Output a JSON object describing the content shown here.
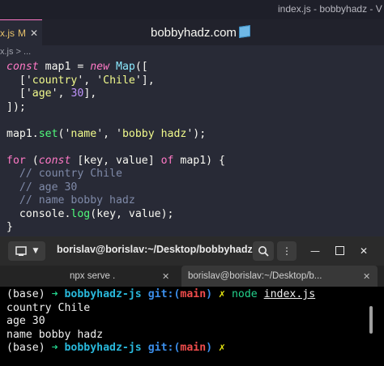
{
  "window": {
    "title": "index.js - bobbyhadz - V"
  },
  "editor_tab": {
    "filename": "x.js",
    "modified_marker": "M",
    "close_glyph": "✕"
  },
  "brand": {
    "text": "bobbyhadz.com",
    "icon": "cube-icon"
  },
  "breadcrumb": "x.js > ...",
  "code": [
    [
      [
        "kw",
        "const"
      ],
      [
        "p",
        " map1 = "
      ],
      [
        "kw",
        "new"
      ],
      [
        "p",
        " "
      ],
      [
        "cls",
        "Map"
      ],
      [
        "p",
        "(["
      ]
    ],
    [
      [
        "ig",
        "  "
      ],
      [
        "p",
        "['"
      ],
      [
        "str",
        "country"
      ],
      [
        "p",
        "', '"
      ],
      [
        "str",
        "Chile"
      ],
      [
        "p",
        "'],"
      ]
    ],
    [
      [
        "ig",
        "  "
      ],
      [
        "p",
        "['"
      ],
      [
        "str",
        "age"
      ],
      [
        "p",
        "', "
      ],
      [
        "num",
        "30"
      ],
      [
        "p",
        "],"
      ]
    ],
    [
      [
        "p",
        "]);"
      ]
    ],
    [
      [
        "p",
        ""
      ]
    ],
    [
      [
        "p",
        "map1."
      ],
      [
        "fn",
        "set"
      ],
      [
        "p",
        "('"
      ],
      [
        "str",
        "name"
      ],
      [
        "p",
        "', '"
      ],
      [
        "str",
        "bobby hadz"
      ],
      [
        "p",
        "');"
      ]
    ],
    [
      [
        "p",
        ""
      ]
    ],
    [
      [
        "pr",
        "for"
      ],
      [
        "p",
        " ("
      ],
      [
        "kw",
        "const"
      ],
      [
        "p",
        " [key, value] "
      ],
      [
        "pr",
        "of"
      ],
      [
        "p",
        " map1) {"
      ]
    ],
    [
      [
        "ig",
        "  "
      ],
      [
        "cm",
        "// country Chile"
      ]
    ],
    [
      [
        "ig",
        "  "
      ],
      [
        "cm",
        "// age 30"
      ]
    ],
    [
      [
        "ig",
        "  "
      ],
      [
        "cm",
        "// name bobby hadz"
      ]
    ],
    [
      [
        "ig",
        "  "
      ],
      [
        "p",
        "console."
      ],
      [
        "fn",
        "log"
      ],
      [
        "p",
        "(key, value);"
      ]
    ],
    [
      [
        "p",
        "}"
      ]
    ]
  ],
  "terminal": {
    "title": "borislav@borislav:~/Desktop/bobbyhadz-r...",
    "new_tab_icon": "new-terminal-icon",
    "search_icon": "search-icon",
    "menu_icon": "kebab-menu-icon",
    "tabs": [
      {
        "label": "npx serve .",
        "close": "✕"
      },
      {
        "label": "borislav@borislav:~/Desktop/b...",
        "close": "✕"
      }
    ],
    "lines": [
      [
        [
          "p",
          "(base) "
        ],
        [
          "g",
          "➜ "
        ],
        [
          "c",
          "bobbyhadz-js "
        ],
        [
          "b",
          "git:("
        ],
        [
          "r",
          "main"
        ],
        [
          "b",
          ") "
        ],
        [
          "y",
          "✗ "
        ],
        [
          "g",
          "node "
        ],
        [
          "u",
          "index.js"
        ]
      ],
      [
        [
          "p",
          "country Chile"
        ]
      ],
      [
        [
          "p",
          "age 30"
        ]
      ],
      [
        [
          "p",
          "name bobby hadz"
        ]
      ],
      [
        [
          "p",
          "(base) "
        ],
        [
          "g",
          "➜ "
        ],
        [
          "c",
          "bobbyhadz-js "
        ],
        [
          "b",
          "git:("
        ],
        [
          "r",
          "main"
        ],
        [
          "b",
          ") "
        ],
        [
          "y",
          "✗"
        ]
      ]
    ]
  }
}
